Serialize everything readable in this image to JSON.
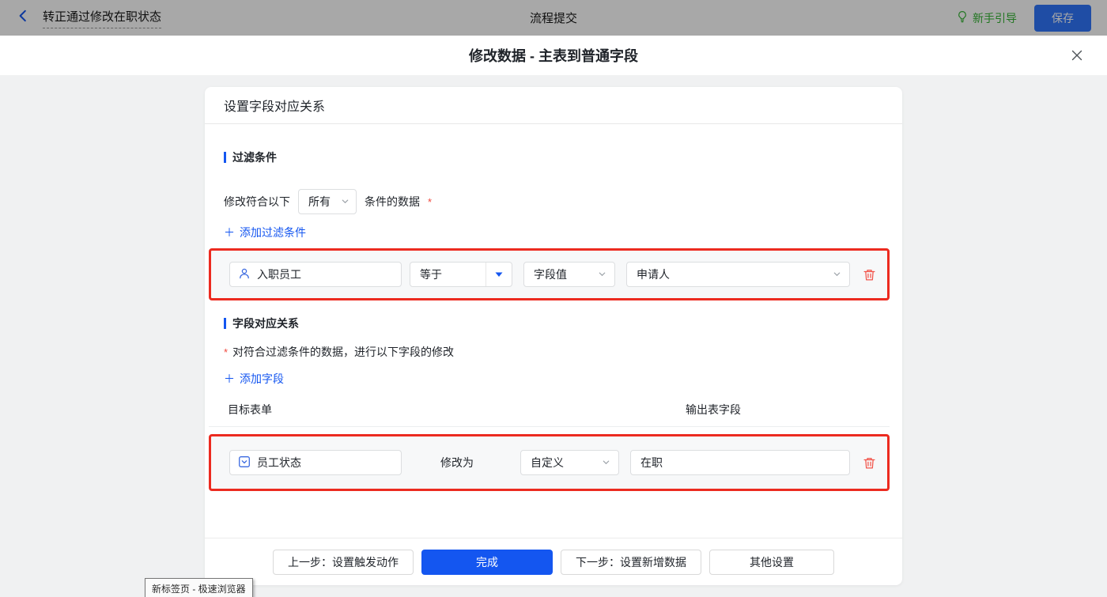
{
  "header": {
    "flow_name": "转正通过修改在职状态",
    "center_title": "流程提交",
    "guide_label": "新手引导",
    "save_label": "保存"
  },
  "modal": {
    "title": "修改数据 - 主表到普通字段",
    "panel_title": "设置字段对应关系",
    "filter_section": {
      "title": "过滤条件",
      "prefix": "修改符合以下",
      "match_select": "所有",
      "suffix": "条件的数据",
      "required_mark": "*",
      "add_link": "添加过滤条件",
      "row": {
        "field": "入职员工",
        "operator": "等于",
        "value_type": "字段值",
        "value": "申请人"
      }
    },
    "mapping_section": {
      "title": "字段对应关系",
      "required_mark": "*",
      "description": "对符合过滤条件的数据，进行以下字段的修改",
      "add_link": "添加字段",
      "col_target": "目标表单",
      "col_output": "输出表字段",
      "row": {
        "field": "员工状态",
        "action_label": "修改为",
        "mode_select": "自定义",
        "value": "在职"
      }
    },
    "footer": {
      "prev_label": "上一步：设置触发动作",
      "done_label": "完成",
      "next_label": "下一步：设置新增数据",
      "other_label": "其他设置"
    }
  },
  "tooltip_text": "新标签页 - 极速浏览器",
  "colors": {
    "accent_blue": "#1456f0",
    "annotation_red": "#ec2b20",
    "guide_green": "#35b434",
    "danger_red": "#f0483e"
  }
}
